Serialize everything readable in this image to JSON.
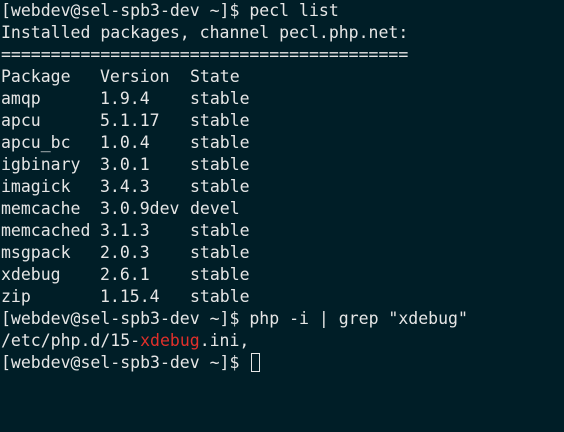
{
  "terminal": {
    "prompt": "[webdev@sel-spb3-dev ~]$ ",
    "commands": {
      "pecl": "pecl list",
      "php": "php -i | grep \"xdebug\""
    },
    "pecl_output": {
      "header": "Installed packages, channel pecl.php.net:",
      "separator": "=========================================",
      "columns": [
        "Package",
        "Version",
        "State"
      ],
      "rows": [
        {
          "name": "amqp",
          "version": "1.9.4",
          "state": "stable"
        },
        {
          "name": "apcu",
          "version": "5.1.17",
          "state": "stable"
        },
        {
          "name": "apcu_bc",
          "version": "1.0.4",
          "state": "stable"
        },
        {
          "name": "igbinary",
          "version": "3.0.1",
          "state": "stable"
        },
        {
          "name": "imagick",
          "version": "3.4.3",
          "state": "stable"
        },
        {
          "name": "memcache",
          "version": "3.0.9dev",
          "state": "devel"
        },
        {
          "name": "memcached",
          "version": "3.1.3",
          "state": "stable"
        },
        {
          "name": "msgpack",
          "version": "2.0.3",
          "state": "stable"
        },
        {
          "name": "xdebug",
          "version": "2.6.1",
          "state": "stable"
        },
        {
          "name": "zip",
          "version": "1.15.4",
          "state": "stable"
        }
      ]
    },
    "grep_output": {
      "prefix": "/etc/php.d/15-",
      "match": "xdebug",
      "suffix": ".ini,"
    },
    "colors": {
      "background": "#001e27",
      "foreground": "#e6e6e6",
      "match_highlight": "#e0302b"
    }
  }
}
